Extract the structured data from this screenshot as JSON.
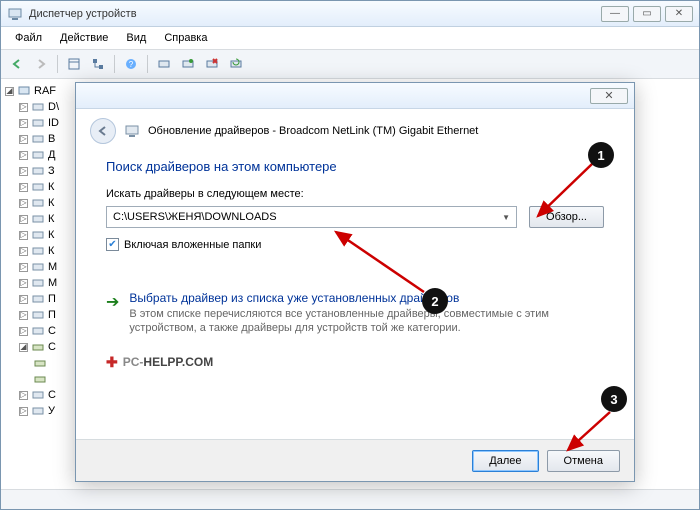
{
  "window": {
    "title": "Диспетчер устройств",
    "min": "—",
    "max": "▭",
    "close": "✕"
  },
  "menu": {
    "file": "Файл",
    "action": "Действие",
    "view": "Вид",
    "help": "Справка"
  },
  "tree": {
    "root": "RAF",
    "items": [
      {
        "label": "D\\"
      },
      {
        "label": "ID"
      },
      {
        "label": "В"
      },
      {
        "label": "Д"
      },
      {
        "label": "З"
      },
      {
        "label": "К"
      },
      {
        "label": "К"
      },
      {
        "label": "К"
      },
      {
        "label": "К"
      },
      {
        "label": "К"
      },
      {
        "label": "М"
      },
      {
        "label": "М"
      },
      {
        "label": "П"
      },
      {
        "label": "П"
      },
      {
        "label": "С"
      }
    ],
    "net_items": [
      {
        "label": ""
      },
      {
        "label": ""
      }
    ],
    "sys_items": [
      {
        "label": "С"
      },
      {
        "label": "У"
      }
    ]
  },
  "dialog": {
    "title_blurred": "                         ",
    "header_text": "Обновление драйверов - Broadcom NetLink (TM) Gigabit Ethernet",
    "section_title": "Поиск драйверов на этом компьютере",
    "field_label": "Искать драйверы в следующем месте:",
    "path_value": "C:\\USERS\\ЖЕНЯ\\DOWNLOADS",
    "browse": "Обзор...",
    "include_sub": "Включая вложенные папки",
    "link_title": "Выбрать драйвер из списка уже установленных драйверов",
    "link_desc": "В этом списке перечисляются все установленные драйверы, совместимые с этим устройством, а также драйверы для устройств той же категории.",
    "brand_pc": "PC-",
    "brand_dom": "HELPP.COM",
    "next": "Далее",
    "cancel": "Отмена"
  },
  "annotations": {
    "n1": "1",
    "n2": "2",
    "n3": "3"
  }
}
